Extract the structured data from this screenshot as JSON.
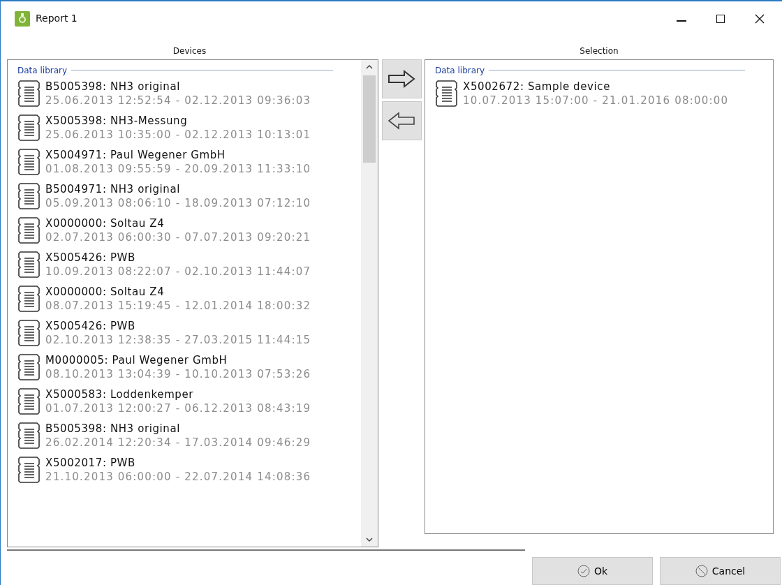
{
  "window": {
    "title": "Report 1"
  },
  "devices": {
    "heading": "Devices",
    "group": "Data library",
    "items": [
      {
        "name": "B5005398: NH3 original",
        "range": "25.06.2013 12:52:54 - 02.12.2013 09:36:03"
      },
      {
        "name": "X5005398: NH3-Messung",
        "range": "25.06.2013 10:35:00 - 02.12.2013 10:13:01"
      },
      {
        "name": "X5004971: Paul Wegener GmbH",
        "range": "01.08.2013 09:55:59 - 20.09.2013 11:33:10"
      },
      {
        "name": "B5004971: NH3 original",
        "range": "05.09.2013 08:06:10 - 18.09.2013 07:12:10"
      },
      {
        "name": "X0000000: Soltau Z4",
        "range": "02.07.2013 06:00:30 - 07.07.2013 09:20:21"
      },
      {
        "name": "X5005426: PWB",
        "range": "10.09.2013 08:22:07 - 02.10.2013 11:44:07"
      },
      {
        "name": "X0000000: Soltau Z4",
        "range": "08.07.2013 15:19:45 - 12.01.2014 18:00:32"
      },
      {
        "name": "X5005426: PWB",
        "range": "02.10.2013 12:38:35 - 27.03.2015 11:44:15"
      },
      {
        "name": "M0000005: Paul Wegener GmbH",
        "range": "08.10.2013 13:04:39 - 10.10.2013 07:53:26"
      },
      {
        "name": "X5000583: Loddenkemper",
        "range": "01.07.2013 12:00:27 - 06.12.2013 08:43:19"
      },
      {
        "name": "B5005398: NH3 original",
        "range": "26.02.2014 12:20:34 - 17.03.2014 09:46:29"
      },
      {
        "name": "X5002017: PWB",
        "range": "21.10.2013 06:00:00 - 22.07.2014 14:08:36"
      }
    ]
  },
  "selection": {
    "heading": "Selection",
    "group": "Data library",
    "items": [
      {
        "name": "X5002672: Sample device",
        "range": "10.07.2013 15:07:00 - 21.01.2016 08:00:00"
      }
    ]
  },
  "buttons": [
    {
      "label": "Ok",
      "kind": "ok"
    },
    {
      "label": "Cancel",
      "kind": "cancel"
    }
  ]
}
